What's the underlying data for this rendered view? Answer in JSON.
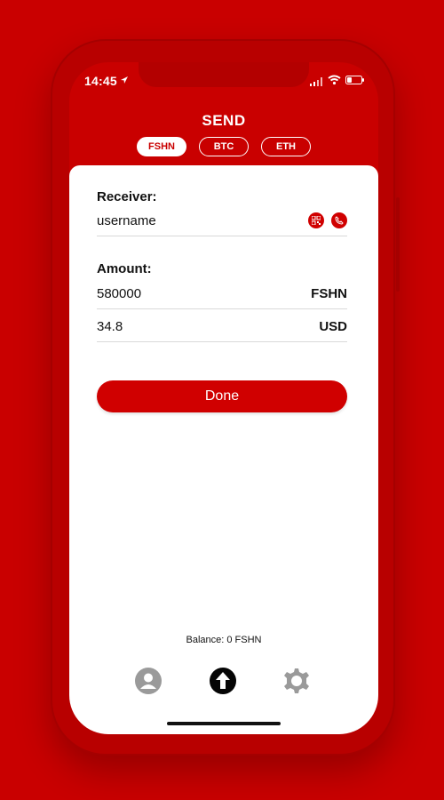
{
  "status": {
    "time": "14:45"
  },
  "header": {
    "title": "SEND"
  },
  "tabs": [
    {
      "label": "FSHN",
      "active": true
    },
    {
      "label": "BTC",
      "active": false
    },
    {
      "label": "ETH",
      "active": false
    }
  ],
  "form": {
    "receiver_label": "Receiver:",
    "receiver_value": "username",
    "amount_label": "Amount:",
    "amount_rows": [
      {
        "value": "580000",
        "unit": "FSHN"
      },
      {
        "value": "34.8",
        "unit": "USD"
      }
    ],
    "done_label": "Done"
  },
  "footer": {
    "balance": "Balance: 0 FSHN"
  },
  "icons": {
    "receiver_actions": [
      "qr-icon",
      "phone-icon"
    ],
    "bottom_nav": [
      "user-icon",
      "send-icon",
      "settings-icon"
    ]
  },
  "colors": {
    "background": "#c90000",
    "accent": "#d00000",
    "panel": "#ffffff",
    "text": "#111111",
    "nav_inactive": "#9a9a9a"
  }
}
